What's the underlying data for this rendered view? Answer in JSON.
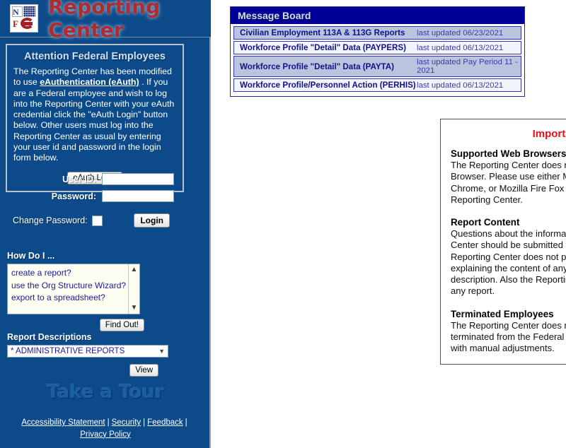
{
  "brand": {
    "title": "Reporting Center",
    "logo_alt": "NFC agency seal logo"
  },
  "attention": {
    "heading": "Attention Federal Employees",
    "body_part1": "The Reporting Center has been modified to use ",
    "link_text": "eAuthentication (eAuth)",
    "body_part2": " . If you are a Federal employee and wish to log into the Reporting Center with your eAuth credential click the \"eAuth Login\" button below. Other users must log into the Reporting Center as usual by entering your user id and password in the login form below.",
    "eauth_button": "eAuth Login"
  },
  "login": {
    "userid_label": "User ID:",
    "userid_value": "",
    "userid_placeholder": "",
    "password_label": "Password:",
    "password_value": "",
    "password_placeholder": "",
    "change_password_label": "Change Password:",
    "change_password_checked": false,
    "login_button": "Login"
  },
  "howdoi": {
    "title": "How Do I ...",
    "options": [
      "create a report?",
      "use the Org Structure Wizard?",
      "export to a spreadsheet?"
    ],
    "scroll_up_icon": "chevron-up",
    "scroll_down_icon": "chevron-down",
    "find_out_button": "Find Out!"
  },
  "report_descriptions": {
    "title": "Report Descriptions",
    "selected": "* ADMINISTRATIVE REPORTS",
    "dropdown_icon": "chevron-down",
    "view_button": "View"
  },
  "tour": {
    "label": "Take a Tour"
  },
  "footer": {
    "links": [
      "Accessibility Statement",
      "Security",
      "Feedback",
      "Privacy Policy"
    ],
    "separator": "|"
  },
  "message_board": {
    "title": "Message Board",
    "rows": [
      {
        "title": "Civilian Employment 113A & 113G Reports",
        "updated": "last updated 06/23/2021",
        "shade": "alt"
      },
      {
        "title": "Workforce Profile \"Detail\" Data (PAYPERS)",
        "updated": "last updated 06/13/2021",
        "shade": "plain"
      },
      {
        "title": "Workforce Profile \"Detail\" Data (PAYTA)",
        "updated": "last updated Pay Period 11 - 2021",
        "shade": "alt"
      },
      {
        "title": "Workforce Profile/Personnel Action (PERHIS)",
        "updated": "last updated 06/13/2021",
        "shade": "plain"
      }
    ]
  },
  "important_info": {
    "heading": "Important Information",
    "sections": [
      {
        "heading": "Supported Web Browsers",
        "body": "The Reporting Center does not support the Microsoft Edge Web Browser. Please use either Microsoft Internet Explorer, Google Chrome, or Mozilla Fire Fox web browsers when accessing the Reporting Center."
      },
      {
        "heading": "Report Content",
        "body": "Questions about the information on any report in the Reporting Center should be submitted to the system administrators. The Reporting Center does not provide any detailed information explaining the content of any report that's not provided in the report description. Also the Reporting Center does not modify any data on any report."
      },
      {
        "heading": "Terminated Employees",
        "body": "The Reporting Center does not display Employees that have been terminated from the Federal Service. This also includes employees with manual adjustments."
      }
    ]
  },
  "colors": {
    "sidebar_bg": "#0c4a8a",
    "header_navy": "#000099",
    "brand_red": "#b02b2b",
    "alert_red": "#e81010",
    "row_alt": "#b9c5dd",
    "row_plain": "#f2f5fb",
    "link_blue": "#11118c"
  }
}
